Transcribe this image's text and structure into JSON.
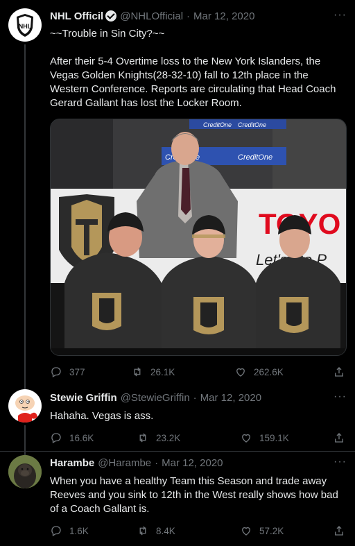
{
  "tweets": [
    {
      "author": "NHL Officil",
      "handle": "@NHLOfficial",
      "date": "Mar 12, 2020",
      "text": "~~Trouble in Sin City?~~\n\nAfter their 5-4 Overtime loss to the New York Islanders, the Vegas Golden Knights(28-32-10) fall to 12th place in the Western Conference. Reports are circulating that Head Coach Gerard Gallant has lost the Locker Room.",
      "replies": "377",
      "retweets": "26.1K",
      "likes": "262.6K",
      "avatar_text": "NHL",
      "media_banner": [
        "CreditOne",
        "CreditOne",
        "CreditOne",
        "CreditOne"
      ],
      "media_sign": "TOYO",
      "media_sign2": "Let's Go P"
    },
    {
      "author": "Stewie Griffin",
      "handle": "@StewieGriffin",
      "date": "Mar 12, 2020",
      "text": "Hahaha. Vegas is ass.",
      "replies": "16.6K",
      "retweets": "23.2K",
      "likes": "159.1K"
    },
    {
      "author": "Harambe",
      "handle": "@Harambe",
      "date": "Mar 12, 2020",
      "text": "When you have a healthy Team this Season and trade away Reeves and you sink to 12th in the West really shows how bad of a Coach Gallant is.",
      "replies": "1.6K",
      "retweets": "8.4K",
      "likes": "57.2K"
    }
  ],
  "colors": {
    "background": "#000000",
    "text": "#e7e9ea",
    "muted": "#71767b",
    "knights_gold": "#b4975a",
    "knights_black": "#2b2b2b",
    "toyota_red": "#e00a1e"
  },
  "icons": [
    "nhl-shield-icon",
    "verified-badge-icon",
    "more-icon",
    "reply-icon",
    "retweet-icon",
    "like-icon",
    "share-icon"
  ]
}
